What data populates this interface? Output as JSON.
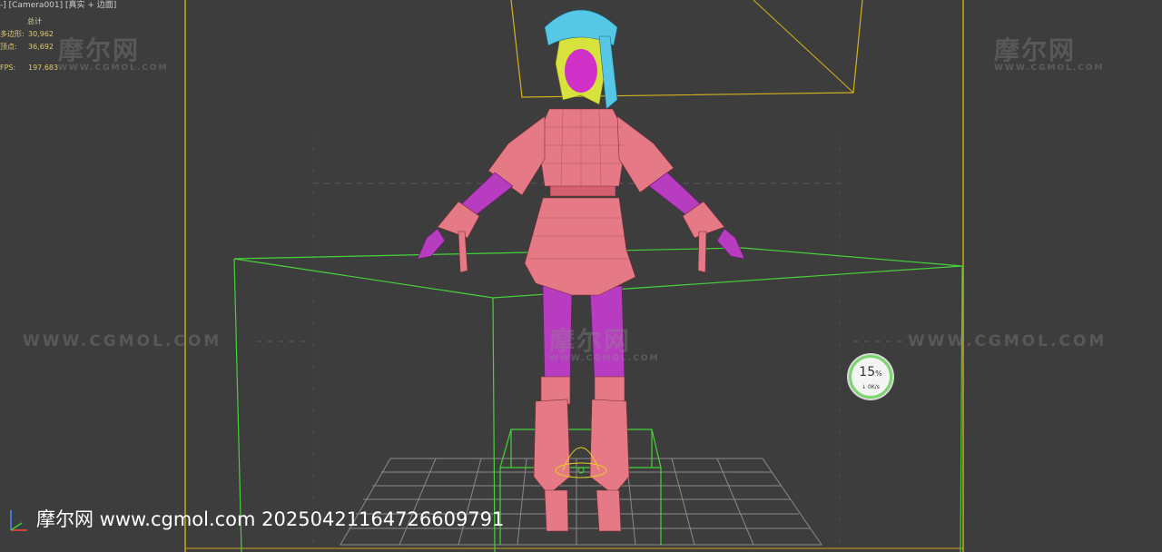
{
  "viewport": {
    "label": "-] [Camera001] [真实 + 边面]",
    "background": "#3d3d3d"
  },
  "stats": {
    "header": "总计",
    "polys_label": "多边形:",
    "polys_value": "30,962",
    "verts_label": "顶点:",
    "verts_value": "36,692",
    "fps_label": "FPS:",
    "fps_value": "197.683"
  },
  "watermarks": {
    "logo": "摩尔网",
    "logo_sub": "WWW.CGMOL.COM",
    "url": "WWW.CGMOL.COM"
  },
  "net_widget": {
    "percent": "15",
    "percent_unit": "%",
    "speed": "↓ 0K/s"
  },
  "footer": {
    "text": "摩尔网 www.cgmol.com 20250421164726609791"
  },
  "colors": {
    "frame": "#d4b21e",
    "bbox": "#46d23a",
    "mesh_body": "#e57a86",
    "mesh_purple": "#c03cc8",
    "hair": "#d8e23c",
    "headdress": "#56c8e6",
    "grid": "#8a8a8a"
  },
  "icons": [
    "world-axis-icon",
    "download-arrow-icon"
  ]
}
